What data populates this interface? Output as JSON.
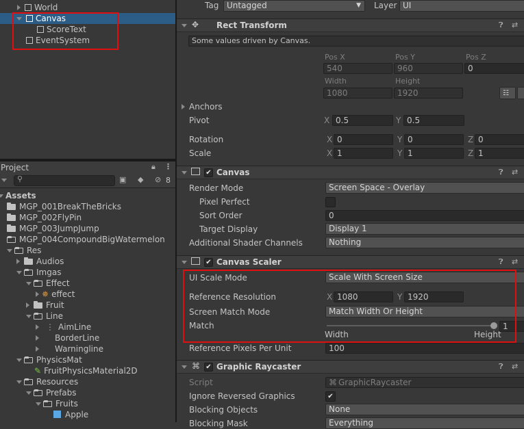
{
  "hierarchy": {
    "items": [
      {
        "label": "World"
      },
      {
        "label": "Canvas"
      },
      {
        "label": "ScoreText"
      },
      {
        "label": "EventSystem"
      }
    ]
  },
  "project": {
    "tab": "Project",
    "hidden_count": "8",
    "root": "Assets",
    "tree": [
      "MGP_001BreakTheBricks",
      "MGP_002FlyPin",
      "MGP_003JumpJump",
      "MGP_004CompoundBigWatermelon",
      "Res",
      "Audios",
      "Imgas",
      "Effect",
      "effect",
      "Fruit",
      "Line",
      "AimLine",
      "BorderLine",
      "Warningline",
      "PhysicsMat",
      "FruitPhysicsMaterial2D",
      "Resources",
      "Prefabs",
      "Fruits",
      "Apple"
    ]
  },
  "inspector": {
    "tag_label": "Tag",
    "tag_value": "Untagged",
    "layer_label": "Layer",
    "layer_value": "UI",
    "rect": {
      "title": "Rect Transform",
      "note": "Some values driven by Canvas.",
      "posx_label": "Pos X",
      "posy_label": "Pos Y",
      "posz_label": "Pos Z",
      "posx": "540",
      "posy": "960",
      "posz": "0",
      "width_label": "Width",
      "height_label": "Height",
      "width": "1080",
      "height": "1920",
      "anchors": "Anchors",
      "pivot": "Pivot",
      "pivot_x": "0.5",
      "pivot_y": "0.5",
      "rotation": "Rotation",
      "rot_x": "0",
      "rot_y": "0",
      "rot_z": "0",
      "scale": "Scale",
      "scale_x": "1",
      "scale_y": "1",
      "scale_z": "1",
      "X": "X",
      "Y": "Y",
      "Z": "Z"
    },
    "canvas": {
      "title": "Canvas",
      "render_mode_label": "Render Mode",
      "render_mode": "Screen Space - Overlay",
      "pixel_perfect": "Pixel Perfect",
      "sort_order_label": "Sort Order",
      "sort_order": "0",
      "target_display_label": "Target Display",
      "target_display": "Display 1",
      "shader_channels_label": "Additional Shader Channels",
      "shader_channels": "Nothing"
    },
    "scaler": {
      "title": "Canvas Scaler",
      "mode_label": "UI Scale Mode",
      "mode": "Scale With Screen Size",
      "ref_res_label": "Reference Resolution",
      "ref_x": "1080",
      "ref_y": "1920",
      "match_mode_label": "Screen Match Mode",
      "match_mode": "Match Width Or Height",
      "match_label": "Match",
      "match_value": "1",
      "match_fraction": 1.0,
      "width_word": "Width",
      "height_word": "Height",
      "ppu_label": "Reference Pixels Per Unit",
      "ppu": "100"
    },
    "raycaster": {
      "title": "Graphic Raycaster",
      "script_label": "Script",
      "script": "GraphicRaycaster",
      "ignore_label": "Ignore Reversed Graphics",
      "blocking_label": "Blocking Objects",
      "blocking": "None",
      "mask_label": "Blocking Mask",
      "mask": "Everything"
    }
  }
}
